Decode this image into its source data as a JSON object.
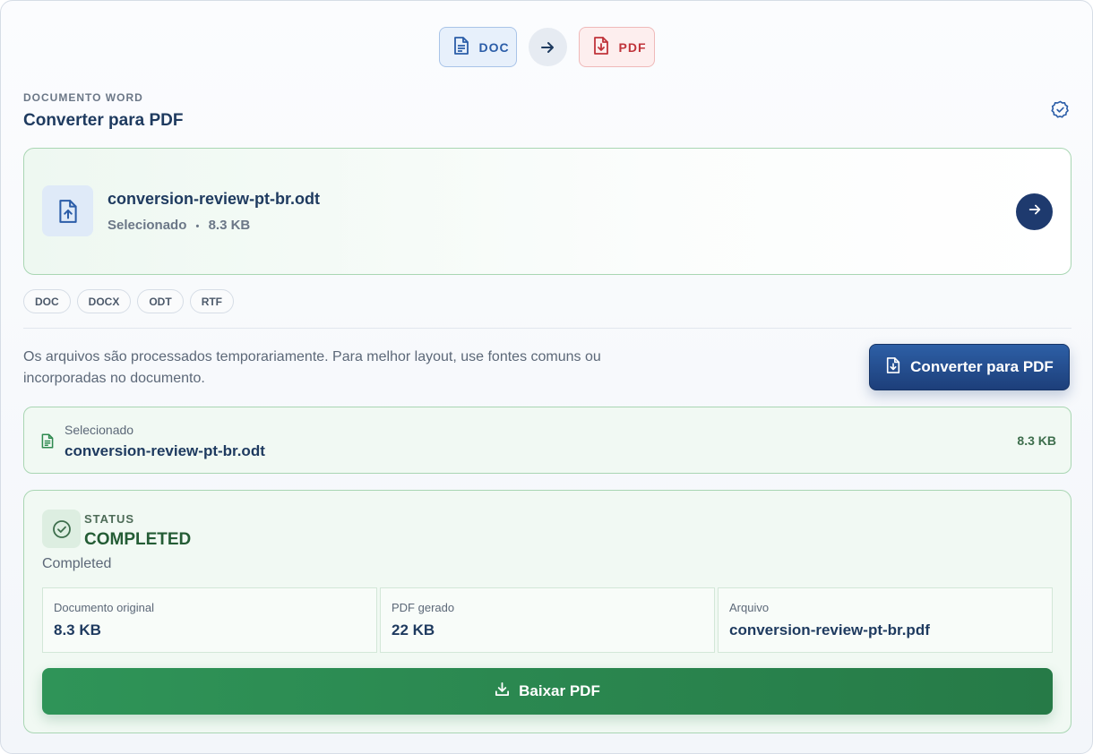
{
  "conversion": {
    "from_label": "DOC",
    "to_label": "PDF"
  },
  "header": {
    "eyebrow": "DOCUMENTO WORD",
    "title": "Converter para PDF"
  },
  "file": {
    "name": "conversion-review-pt-br.odt",
    "state": "Selecionado",
    "separator": "•",
    "size": "8.3 KB"
  },
  "formats": [
    "DOC",
    "DOCX",
    "ODT",
    "RTF"
  ],
  "note": "Os arquivos são processados temporariamente. Para melhor layout, use fontes comuns ou incorporadas no documento.",
  "convert_button": {
    "label": "Converter para PDF"
  },
  "selected": {
    "label": "Selecionado",
    "name": "conversion-review-pt-br.odt",
    "size": "8.3 KB"
  },
  "status": {
    "label": "STATUS",
    "value": "COMPLETED",
    "description": "Completed",
    "stats": [
      {
        "label": "Documento original",
        "value": "8.3 KB"
      },
      {
        "label": "PDF gerado",
        "value": "22 KB"
      },
      {
        "label": "Arquivo",
        "value": "conversion-review-pt-br.pdf"
      }
    ]
  },
  "download_button": {
    "label": "Baixar PDF"
  },
  "colors": {
    "accent": "#1e3a6e",
    "success": "#2f9458",
    "pdf_red": "#c0343b",
    "doc_blue": "#2b5da8"
  }
}
